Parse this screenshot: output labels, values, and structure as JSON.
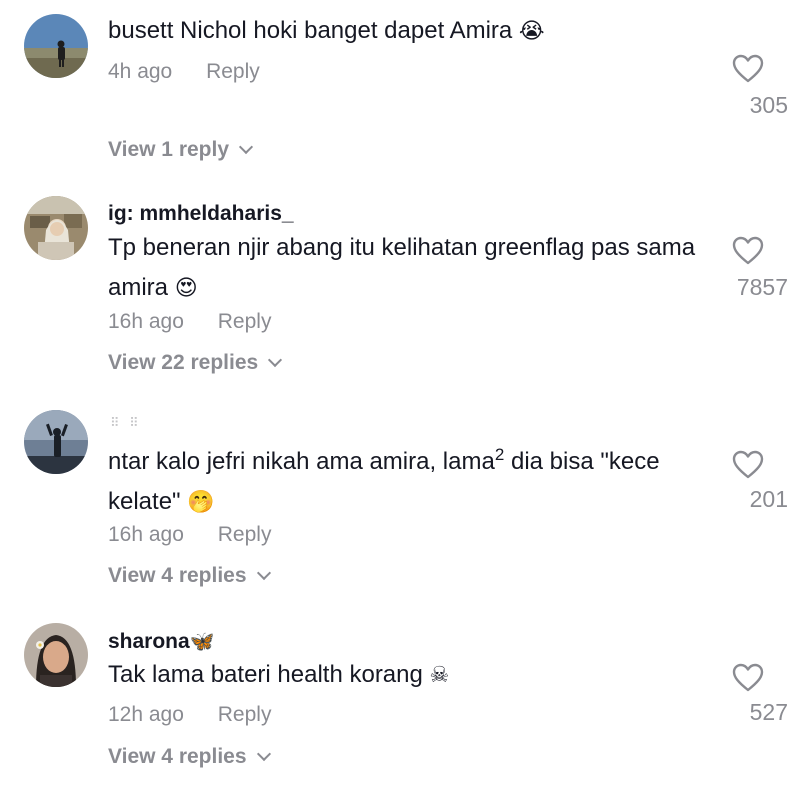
{
  "comments": [
    {
      "username": "",
      "text": "busett Nichol hoki banget dapet Amira",
      "emoji": "😭",
      "time": "4h ago",
      "reply_label": "Reply",
      "likes": "305",
      "view_replies": "View 1 reply"
    },
    {
      "username": "ig: mmheldaharis_",
      "text": "Tp beneran njir abang itu kelihatan greenflag pas sama amira",
      "emoji": "😍",
      "time": "16h ago",
      "reply_label": "Reply",
      "likes": "7857",
      "view_replies": "View 22 replies"
    },
    {
      "username": "",
      "dots": "⠿ ⠿",
      "text_part1": "ntar kalo jefri nikah ama amira, lama",
      "superscript": "2",
      "text_part2": " dia bisa \"kece kelate\"",
      "emoji": "🤭",
      "time": "16h ago",
      "reply_label": "Reply",
      "likes": "201",
      "view_replies": "View 4 replies"
    },
    {
      "username": "sharona",
      "username_badge": "🦋",
      "text": "Tak lama bateri health korang",
      "emoji": "☠",
      "time": "12h ago",
      "reply_label": "Reply",
      "likes": "527",
      "view_replies": "View 4 replies"
    }
  ],
  "icons": {
    "like": "heart-outline-icon",
    "expand": "chevron-down-icon"
  },
  "colors": {
    "text_primary": "#161823",
    "text_secondary": "#8a8b91",
    "heart_stroke": "#8a8b91"
  }
}
